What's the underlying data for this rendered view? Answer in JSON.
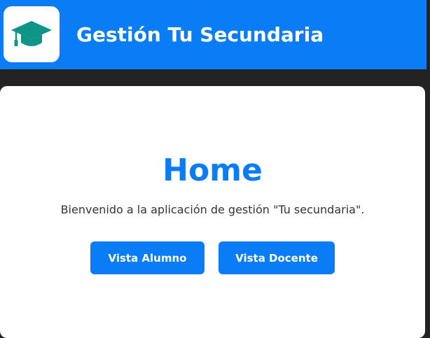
{
  "header": {
    "title": "Gestión Tu Secundaria",
    "logo_icon": "graduation-cap-icon",
    "background_color": "#0a7cf5"
  },
  "main": {
    "title": "Home",
    "welcome_text": "Bienvenido a la aplicación de gestión \"Tu secundaria\".",
    "buttons": [
      {
        "label": "Vista Alumno"
      },
      {
        "label": "Vista Docente"
      }
    ]
  },
  "colors": {
    "accent": "#0a7cf5",
    "logo_cap": "#0f9488",
    "page_background": "#232323",
    "card_background": "#ffffff"
  }
}
